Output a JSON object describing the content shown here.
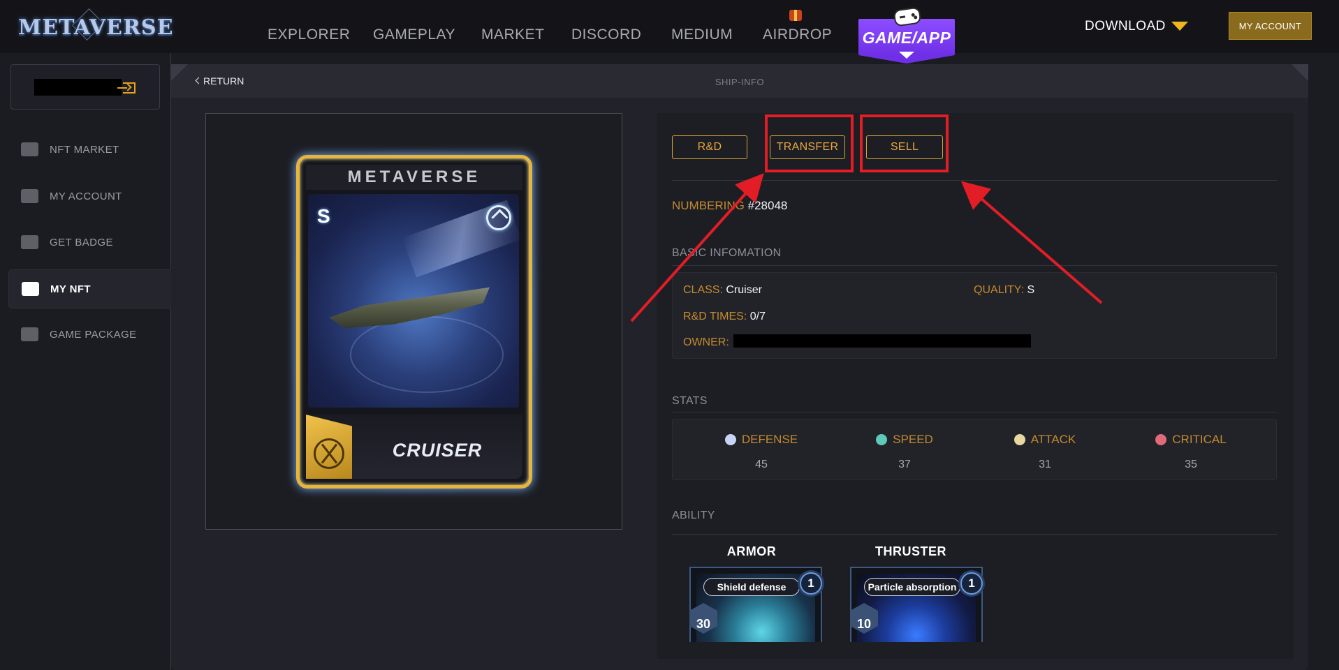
{
  "header": {
    "logo_text": "METAVERSE",
    "nav": [
      {
        "label": "EXPLORER"
      },
      {
        "label": "GAMEPLAY"
      },
      {
        "label": "MARKET"
      },
      {
        "label": "DISCORD"
      },
      {
        "label": "MEDIUM"
      },
      {
        "label": "AIRDROP"
      }
    ],
    "game_app_label": "GAME/APP",
    "download_label": "DOWNLOAD",
    "my_account_label": "MY ACCOUNT"
  },
  "sidebar": {
    "items": [
      {
        "label": "NFT MARKET",
        "icon": "cart-icon"
      },
      {
        "label": "MY ACCOUNT",
        "icon": "envelope-icon"
      },
      {
        "label": "GET BADGE",
        "icon": "wallet-icon"
      },
      {
        "label": "MY NFT",
        "icon": "image-icon",
        "active": true
      },
      {
        "label": "GAME PACKAGE",
        "icon": "gamepad-icon"
      }
    ]
  },
  "panel": {
    "return_label": "RETURN",
    "title": "SHIP-INFO"
  },
  "card": {
    "brand": "METAVERSE",
    "rank": "S",
    "name": "CRUISER"
  },
  "actions": {
    "rd_label": "R&D",
    "transfer_label": "TRANSFER",
    "sell_label": "SELL"
  },
  "numbering": {
    "label": "NUMBERING",
    "value": "#28048"
  },
  "basic_info": {
    "title": "BASIC INFOMATION",
    "class_label": "CLASS:",
    "class_value": "Cruiser",
    "quality_label": "QUALITY:",
    "quality_value": "S",
    "rd_times_label": "R&D TIMES:",
    "rd_times_value": "0/7",
    "owner_label": "OWNER:"
  },
  "stats": {
    "title": "STATS",
    "items": [
      {
        "label": "DEFENSE",
        "value": "45",
        "color": "#c9d3f5"
      },
      {
        "label": "SPEED",
        "value": "37",
        "color": "#5fc9b8"
      },
      {
        "label": "ATTACK",
        "value": "31",
        "color": "#e8d7a0"
      },
      {
        "label": "CRITICAL",
        "value": "35",
        "color": "#e06a7a"
      }
    ]
  },
  "ability": {
    "title": "ABILITY",
    "items": [
      {
        "name": "ARMOR",
        "banner": "Shield defense",
        "level": "1",
        "cost": "30"
      },
      {
        "name": "THRUSTER",
        "banner": "Particle absorption",
        "level": "1",
        "cost": "10"
      }
    ]
  },
  "colors": {
    "accent_gold": "#c48a2f",
    "button_border": "#d7a33a",
    "game_app_purple": "#7a38f0",
    "annotation_red": "#e21d26"
  }
}
